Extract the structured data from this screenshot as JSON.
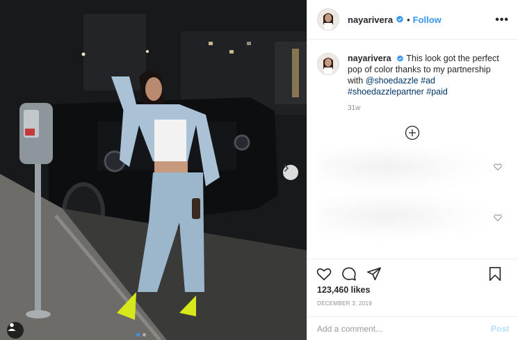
{
  "post": {
    "username": "nayarivera",
    "verified_icon": "verified-badge-icon",
    "separator": "•",
    "follow_label": "Follow",
    "more_label": "•••",
    "caption": {
      "username": "nayarivera",
      "text_1": " This look got the perfect pop of color thanks to my partnership with ",
      "mention": "@shoedazzle",
      "hashtag_1": "#ad",
      "hashtag_2": "#shoedazzlepartner",
      "hashtag_3": "#paid"
    },
    "time_ago": "31w",
    "likes": "123,460 likes",
    "date": "DECEMBER 3, 2019",
    "comment_placeholder": "Add a comment...",
    "post_label": "Post"
  },
  "colors": {
    "accent": "#3897f0",
    "text": "#262626",
    "muted": "#8e8e8e",
    "post_disabled": "#b2dffc"
  },
  "icons": {
    "like": "heart-icon",
    "comment": "comment-icon",
    "share": "share-icon",
    "save": "bookmark-icon",
    "load_more": "plus-circle-icon",
    "next": "chevron-right-icon",
    "tags": "user-tag-icon"
  }
}
